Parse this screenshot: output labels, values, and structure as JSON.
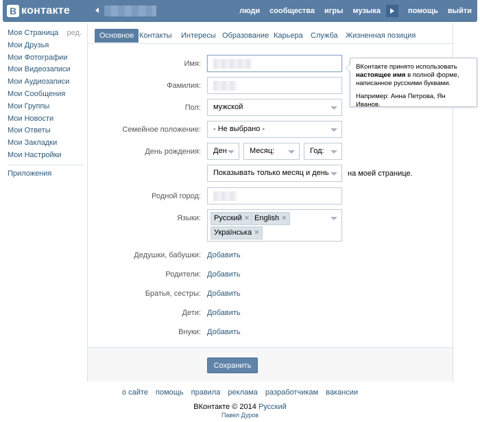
{
  "header": {
    "logo_mark": "В",
    "logo_text": "контакте",
    "nav": [
      "люди",
      "сообщества",
      "игры",
      "музыка",
      "помощь",
      "выйти"
    ]
  },
  "sidebar": {
    "items": [
      {
        "label": "Моя Страница"
      },
      {
        "label": "Мои Друзья"
      },
      {
        "label": "Мои Фотографии"
      },
      {
        "label": "Мои Видеозаписи"
      },
      {
        "label": "Мои Аудиозаписи"
      },
      {
        "label": "Мои Сообщения"
      },
      {
        "label": "Мои Группы"
      },
      {
        "label": "Мои Новости"
      },
      {
        "label": "Мои Ответы"
      },
      {
        "label": "Мои Закладки"
      },
      {
        "label": "Мои Настройки"
      }
    ],
    "edit_label": "ред.",
    "apps_label": "Приложения"
  },
  "tabs": [
    "Основное",
    "Контакты",
    "Интересы",
    "Образование",
    "Карьера",
    "Служба",
    "Жизненная позиция"
  ],
  "form": {
    "first_name_label": "Имя:",
    "last_name_label": "Фамилия:",
    "gender_label": "Пол:",
    "gender_value": "мужской",
    "marital_label": "Семейное положение:",
    "marital_value": "- Не выбрано -",
    "birthday_label": "День рождения:",
    "day_value": "Ден",
    "month_value": "Месяц:",
    "year_value": "Год:",
    "birthday_visibility_value": "Показывать только месяц и день",
    "birthday_visibility_note": "на моей странице.",
    "hometown_label": "Родной город:",
    "languages_label": "Языки:",
    "languages": [
      "Русский",
      "English",
      "Українська"
    ],
    "relatives": [
      {
        "label": "Дедушки, бабушки:",
        "action": "Добавить"
      },
      {
        "label": "Родители:",
        "action": "Добавить"
      },
      {
        "label": "Братья, сестры:",
        "action": "Добавить"
      },
      {
        "label": "Дети:",
        "action": "Добавить"
      },
      {
        "label": "Внуки:",
        "action": "Добавить"
      }
    ],
    "save_label": "Сохранить"
  },
  "tooltip": {
    "line1": "ВКонтакте принято использовать",
    "bold": "настоящее имя",
    "line2_rest": " в полной форме,",
    "line3": "написанное русскими буквами.",
    "example": "Например: Анна Петрова, Ян Иванов."
  },
  "footer": {
    "links": [
      "о сайте",
      "помощь",
      "правила",
      "реклама",
      "разработчикам",
      "вакансии"
    ],
    "copyright": "ВКонтакте © 2014",
    "language": "Русский",
    "author": "Павел Дуров"
  },
  "colors": {
    "header_bg": "#597da3",
    "link": "#2b587a",
    "button": "#6083a8"
  }
}
